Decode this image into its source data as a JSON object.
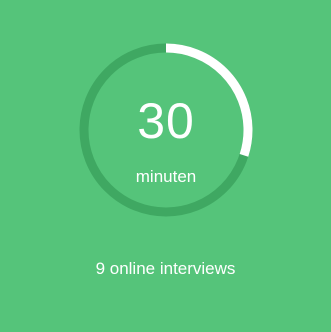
{
  "card": {
    "background": "#55c47a",
    "value": "30",
    "unit": "minuten",
    "caption": "9 online interviews"
  },
  "gauge": {
    "progress": 0.3,
    "track_color": "#3fa862",
    "progress_color": "#ffffff"
  }
}
